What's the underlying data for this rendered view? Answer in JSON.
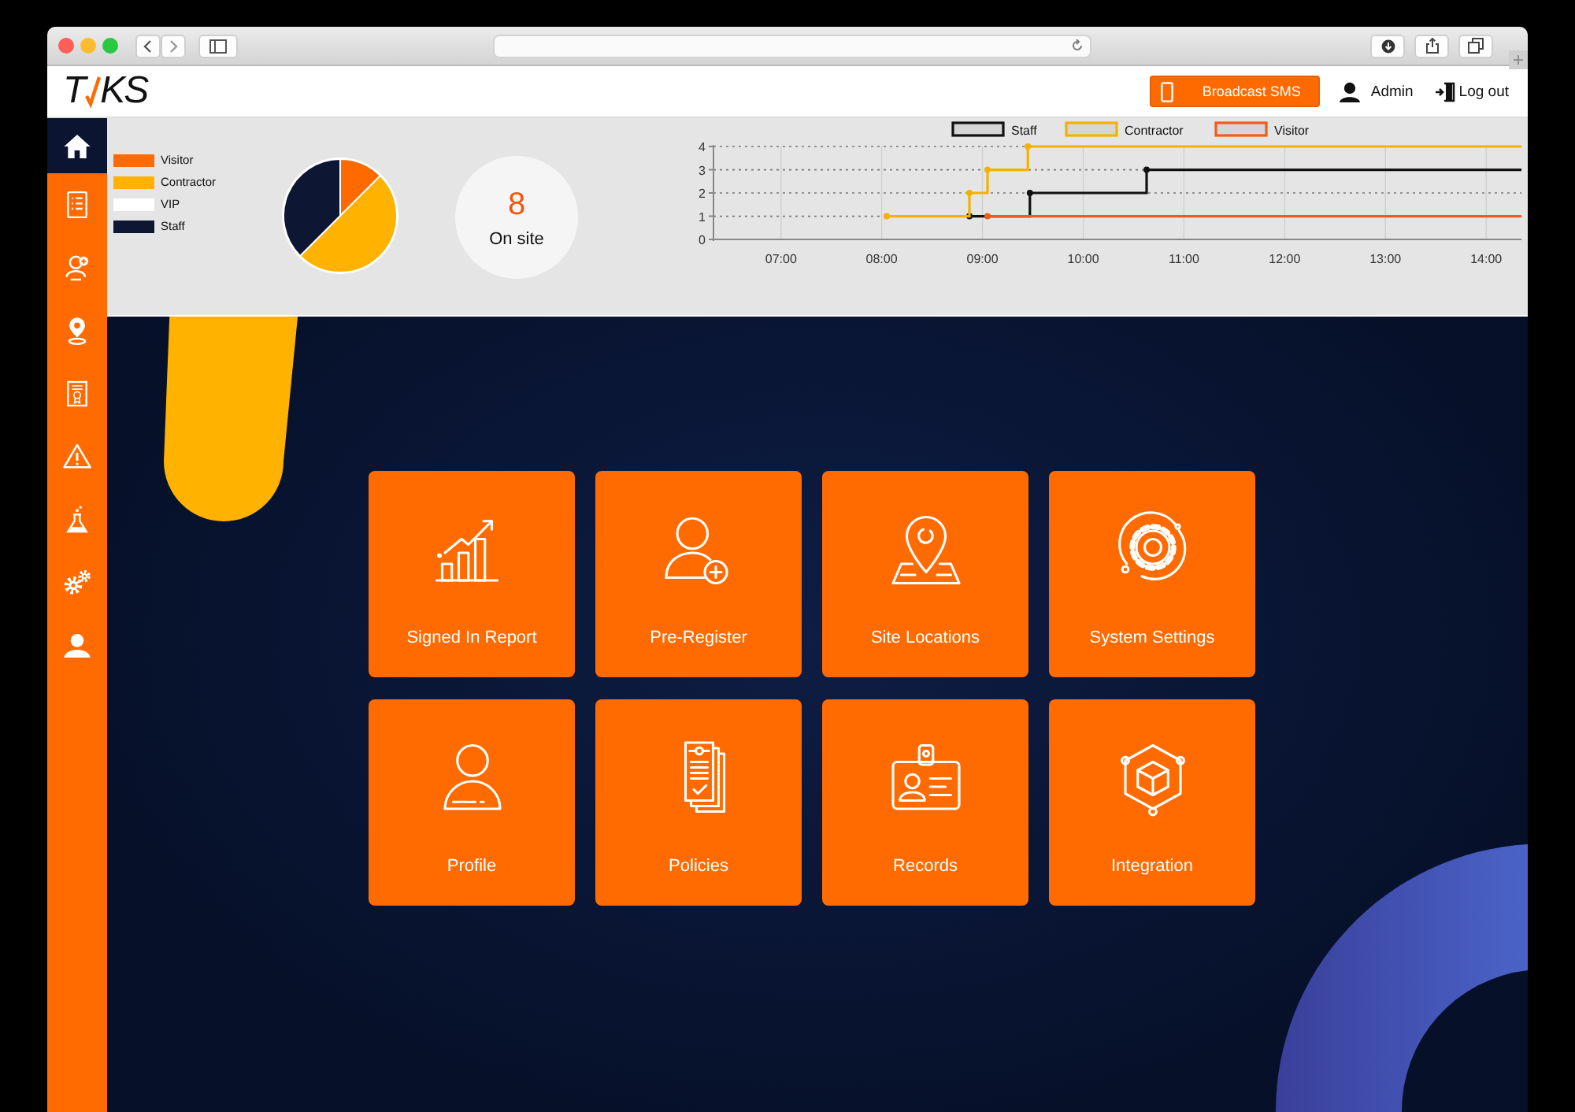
{
  "header": {
    "logo": {
      "left": "T",
      "right": "KS"
    },
    "broadcast_button": "Broadcast SMS",
    "user": "Admin",
    "logout": "Log out",
    "new_tab": "+"
  },
  "sidebar": {
    "items": [
      {
        "kind": "home",
        "selected": true
      },
      {
        "kind": "report",
        "selected": false
      },
      {
        "kind": "visitor",
        "selected": false
      },
      {
        "kind": "location",
        "selected": false
      },
      {
        "kind": "badge",
        "selected": false
      },
      {
        "kind": "warning",
        "selected": false
      },
      {
        "kind": "lab",
        "selected": false
      },
      {
        "kind": "settings",
        "selected": false
      },
      {
        "kind": "user",
        "selected": false
      }
    ]
  },
  "summary": {
    "legend": [
      {
        "color": "#ff6a00"
      },
      {
        "color": "#ffb300"
      },
      {
        "color": "#ffffff"
      },
      {
        "color": "#0d1633"
      }
    ],
    "pie": {
      "chart_data": {
        "type": "pie",
        "categories": [
          "Visitor",
          "Contractor",
          "VIP",
          "Staff"
        ],
        "values": [
          12.5,
          50,
          0,
          37.5
        ]
      }
    },
    "on_site": {
      "count": "8",
      "label": "On site"
    },
    "timeline": {
      "chart_data": {
        "type": "line",
        "grid": true,
        "legend": "top",
        "x": [
          8.05,
          8.87,
          8.87,
          9.05,
          9.05,
          9.45,
          9.45,
          9.47,
          9.47,
          10.63,
          10.63,
          14.35
        ],
        "series": [
          {
            "name": "Staff",
            "color": "#111111",
            "values": [
              null,
              1,
              1,
              1,
              1,
              1,
              1,
              1,
              2,
              2,
              3,
              3
            ]
          },
          {
            "name": "Contractor",
            "color": "#f5b100",
            "values": [
              1,
              1,
              2,
              2,
              3,
              3,
              4,
              4,
              4,
              4,
              4,
              4
            ]
          },
          {
            "name": "Visitor",
            "color": "#f05a1a",
            "values": [
              null,
              null,
              null,
              1,
              1,
              1,
              1,
              1,
              1,
              1,
              1,
              1
            ]
          }
        ],
        "xlim": [
          6.33,
          14.35
        ],
        "ylim": [
          0,
          4
        ],
        "xticks": [
          {
            "value": 7,
            "label": "07:00"
          },
          {
            "value": 8,
            "label": "08:00"
          },
          {
            "value": 9,
            "label": "09:00"
          },
          {
            "value": 10,
            "label": "10:00"
          },
          {
            "value": 11,
            "label": "11:00"
          },
          {
            "value": 12,
            "label": "12:00"
          },
          {
            "value": 13,
            "label": "13:00"
          },
          {
            "value": 14,
            "label": "14:00"
          }
        ],
        "yticks": [
          0,
          1,
          2,
          3,
          4
        ]
      }
    }
  },
  "tiles": [
    {
      "kind": "report",
      "label": "Signed In Report"
    },
    {
      "kind": "preregister",
      "label": "Pre-Register"
    },
    {
      "kind": "location",
      "label": "Site Locations"
    },
    {
      "kind": "settings",
      "label": "System Settings"
    },
    {
      "kind": "profile",
      "label": "Profile"
    },
    {
      "kind": "policies",
      "label": "Policies"
    },
    {
      "kind": "records",
      "label": "Records"
    },
    {
      "kind": "integration",
      "label": "Integration"
    }
  ]
}
